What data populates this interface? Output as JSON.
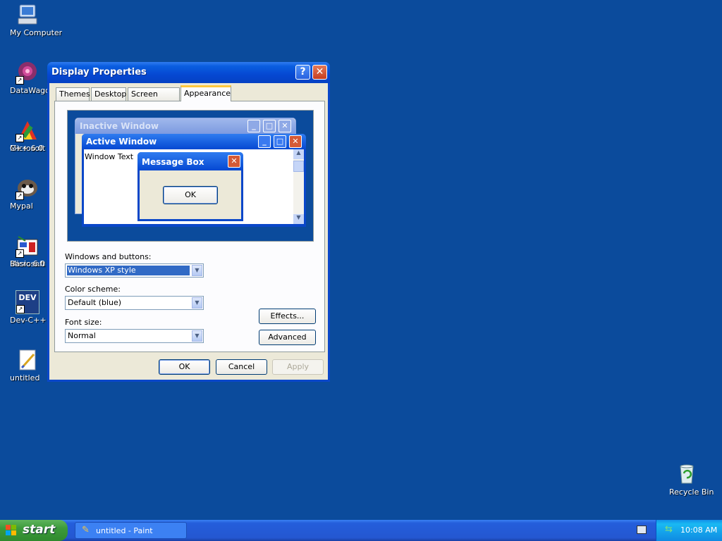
{
  "desktop": {
    "icons": [
      {
        "label": "My Computer",
        "icon": "my-computer-icon"
      },
      {
        "label": "DataWagon.",
        "icon": "datawagon-icon"
      },
      {
        "label": "Microsoft Visu",
        "label2": "C++ 6.0",
        "icon": "visual-cpp-icon"
      },
      {
        "label": "Mypal",
        "icon": "mypal-icon"
      },
      {
        "label": "Microsoft Visu",
        "label2": "Basic 6.0",
        "icon": "visual-basic-icon"
      },
      {
        "label": "Dev-C++",
        "icon": "dev-cpp-icon",
        "badge": "DEV"
      },
      {
        "label": "untitled",
        "icon": "paint-file-icon"
      },
      {
        "label": "Recycle Bin",
        "icon": "recycle-bin-icon"
      }
    ]
  },
  "window": {
    "title": "Display Properties",
    "help_glyph": "?",
    "close_glyph": "✕",
    "tabs": [
      "Themes",
      "Desktop",
      "Screen Saver",
      "Appearance"
    ],
    "active_tab": "Appearance",
    "preview": {
      "inactive_title": "Inactive Window",
      "active_title": "Active Window",
      "window_text": "Window Text",
      "message_title": "Message Box",
      "message_ok": "OK"
    },
    "form": {
      "windows_buttons_label": "Windows and buttons:",
      "windows_buttons_value": "Windows XP style",
      "color_scheme_label": "Color scheme:",
      "color_scheme_value": "Default (blue)",
      "font_size_label": "Font size:",
      "font_size_value": "Normal",
      "effects_label": "Effects...",
      "advanced_label": "Advanced"
    },
    "buttons": {
      "ok": "OK",
      "cancel": "Cancel",
      "apply": "Apply"
    }
  },
  "taskbar": {
    "start_label": "start",
    "task_label": "untitled - Paint",
    "clock": "10:08 AM"
  },
  "colors": {
    "desktop": "#0b4b9c",
    "titlebar": "#0548d2",
    "dialog": "#ece9d8",
    "selection": "#316ac5"
  }
}
